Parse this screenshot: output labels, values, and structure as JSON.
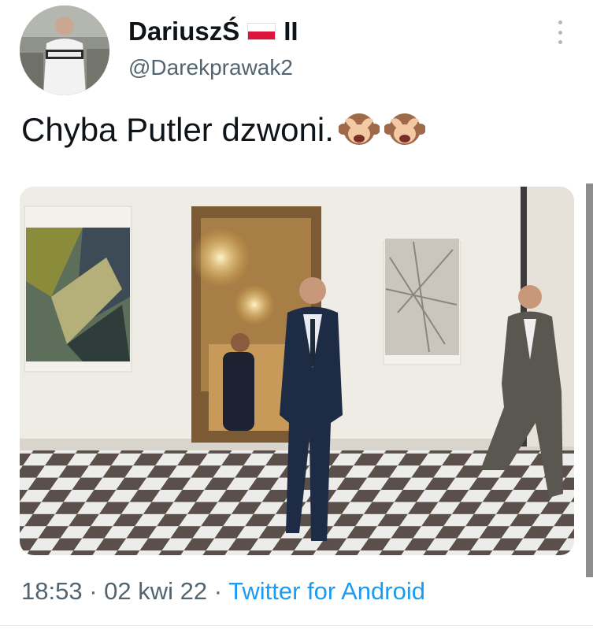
{
  "tweet": {
    "display_name": "DariuszŚ",
    "name_suffix": "II",
    "handle": "@Darekprawak2",
    "text": "Chyba Putler dzwoni.",
    "emojis": [
      "see-no-evil-monkey-icon",
      "see-no-evil-monkey-icon"
    ],
    "time": "18:53",
    "date": "02 kwi 22",
    "separator": " · ",
    "source": "Twitter for Android"
  },
  "colors": {
    "text": "#0f1419",
    "secondary": "#536471",
    "link": "#1d9bf0",
    "flag_white": "#ffffff",
    "flag_red": "#dc143c"
  },
  "icons": {
    "more": "more-vertical-icon",
    "flag": "poland-flag-icon"
  }
}
